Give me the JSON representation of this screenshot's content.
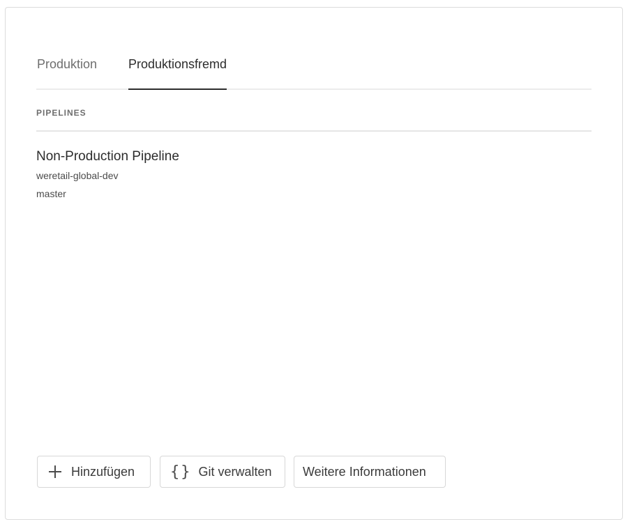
{
  "tabs": [
    {
      "label": "Produktion",
      "active": false
    },
    {
      "label": "Produktionsfremd",
      "active": true
    }
  ],
  "section": {
    "header": "PIPELINES"
  },
  "pipelines": [
    {
      "name": "Non-Production Pipeline",
      "program": "weretail-global-dev",
      "branch": "master"
    }
  ],
  "actions": {
    "add_label": "Hinzufügen",
    "add_icon": "plus-icon",
    "git_label": "Git verwalten",
    "git_icon": "braces-icon",
    "git_icon_glyph": "{}",
    "info_label": "Weitere Informationen"
  },
  "colors": {
    "active_tab_underline": "#2c2c2c",
    "inactive_text": "#6e6e6e",
    "border": "#d7d7d7"
  }
}
